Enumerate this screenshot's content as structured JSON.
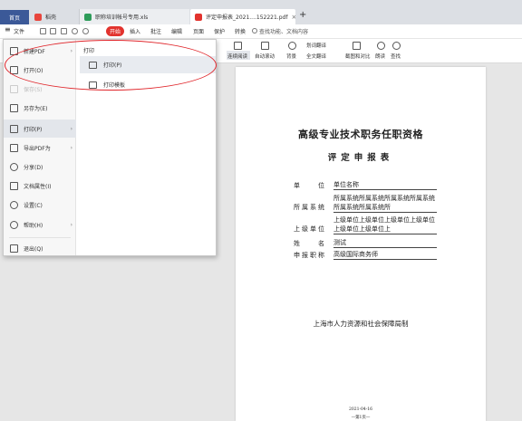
{
  "tabs": {
    "home": "首页",
    "daoke": "稻壳",
    "xls_name": "职称培训帐号专用.xls",
    "pdf_name": "评定申报表_2021....152221.pdf",
    "close": "×",
    "add": "+"
  },
  "toolbar": {
    "menu_icon": "≡",
    "file_label": "文件",
    "start": "开始",
    "insert": "插入",
    "annotate": "批注",
    "edit": "编辑",
    "page": "页面",
    "protect": "保护",
    "convert": "转换",
    "search_text": "查找功能、文档内容"
  },
  "ribbon": {
    "continuous_read": "连续阅读",
    "auto_scroll": "自动滚动",
    "background": "背景",
    "translate_label": "划词翻译",
    "full_translate": "全文翻译",
    "screenshot_compare": "截图和对比",
    "read_aloud": "朗读",
    "find": "查找"
  },
  "file_menu": {
    "left_items": [
      {
        "label": "新建PDF",
        "icon": "new-pdf-icon",
        "arrow": "›"
      },
      {
        "label": "打开(O)",
        "icon": "folder-open-icon"
      },
      {
        "label": "保存(S)",
        "icon": "save-icon"
      },
      {
        "label": "另存为(E)",
        "icon": "save-as-icon"
      },
      {
        "label": "打印(P)",
        "icon": "printer-icon",
        "arrow": "›"
      },
      {
        "label": "导出PDF为",
        "icon": "export-pdf-icon",
        "arrow": "›"
      },
      {
        "label": "分享(D)",
        "icon": "share-icon"
      },
      {
        "label": "文档属性(I)",
        "icon": "document-properties-icon"
      },
      {
        "label": "设置(C)",
        "icon": "settings-icon"
      },
      {
        "label": "帮助(H)",
        "icon": "help-icon",
        "arrow": "›"
      },
      {
        "label": "退出(Q)",
        "icon": "exit-icon"
      }
    ],
    "submenu_title": "打印",
    "submenu_items": [
      {
        "label": "打印(P)",
        "icon": "printer-icon"
      },
      {
        "label": "打印模板",
        "icon": "print-template-icon"
      }
    ]
  },
  "document": {
    "title": "高级专业技术职务任职资格",
    "subtitle": "评定申报表",
    "fields": [
      {
        "label": "单位",
        "value": "单位名称"
      },
      {
        "label": "所属系统",
        "value": "所属系统所属系统所属系统所属系统所属系统所属系统所"
      },
      {
        "label": "上级单位",
        "value": "上级单位上级单位上级单位上级单位上级单位上级单位上"
      },
      {
        "label": "姓名",
        "value": "测试"
      },
      {
        "label": "申报职称",
        "value": "高级国际商务师"
      }
    ],
    "org": "上海市人力资源和社会保障局制",
    "date": "2021-04-16",
    "page_no": "—第1页—"
  },
  "colors": {
    "accent_red": "#e2332e",
    "home_tab": "#3b5998",
    "annotation": "#e0252a"
  }
}
